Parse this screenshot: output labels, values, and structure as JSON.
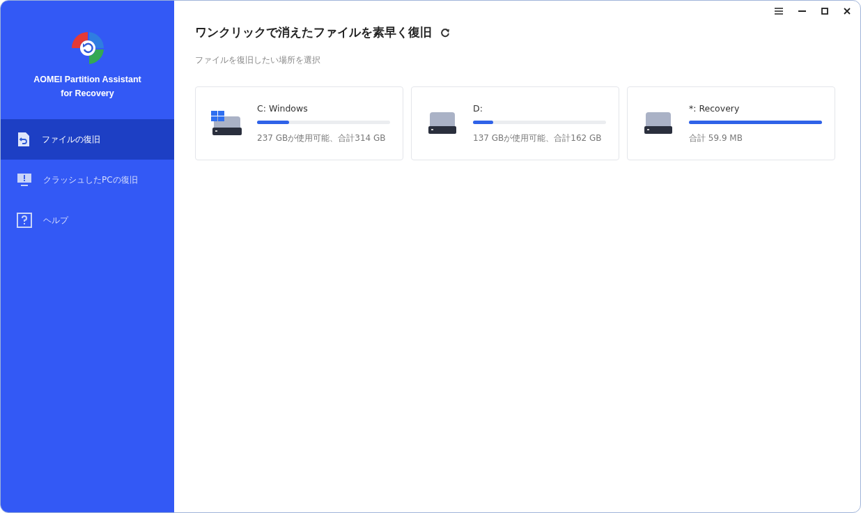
{
  "app": {
    "name_line1": "AOMEI Partition Assistant",
    "name_line2": "for Recovery"
  },
  "sidebar": {
    "items": [
      {
        "label": "ファイルの復旧",
        "selected": true,
        "kind": "file"
      },
      {
        "label": "クラッシュしたPCの復旧",
        "selected": false,
        "kind": "crash"
      },
      {
        "label": "ヘルプ",
        "selected": false,
        "kind": "help"
      }
    ]
  },
  "main": {
    "title": "ワンクリックで消えたファイルを素早く復旧",
    "subtitle": "ファイルを復旧したい場所を選択"
  },
  "drives": [
    {
      "name": "C: Windows",
      "kind": "system",
      "level": 0.24,
      "info": "237 GBが使用可能、合計314 GB"
    },
    {
      "name": "D:",
      "kind": "disk",
      "level": 0.15,
      "info": "137 GBが使用可能、合計162 GB"
    },
    {
      "name": "*: Recovery",
      "kind": "disk",
      "level": 1.0,
      "info": "合計 59.9 MB"
    }
  ]
}
